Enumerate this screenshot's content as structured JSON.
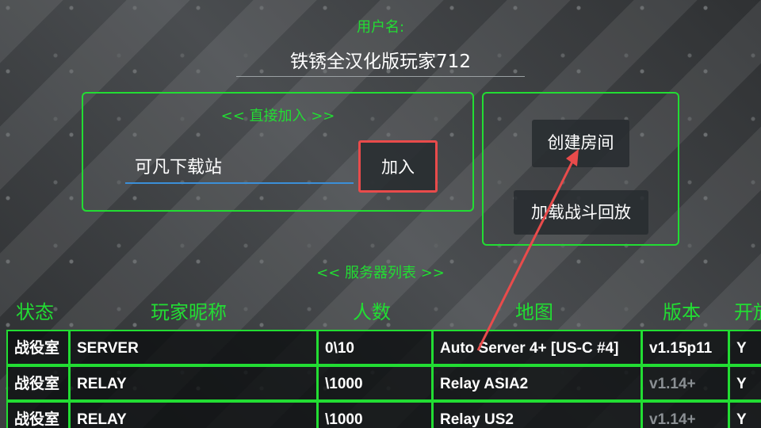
{
  "username": {
    "label": "用户名:",
    "value": "铁锈全汉化版玩家712"
  },
  "direct_join": {
    "title": "<< 直接加入 >>",
    "input_value": "可凡下载站",
    "join_label": "加入"
  },
  "room_panel": {
    "create_room_label": "创建房间",
    "load_replay_label": "加载战斗回放"
  },
  "server_list": {
    "title": "<< 服务器列表 >>",
    "columns": [
      "状态",
      "玩家昵称",
      "人数",
      "地图",
      "版本",
      "开放"
    ],
    "rows": [
      [
        "战役室",
        "SERVER",
        "0\\10",
        "Auto Server 4+ [US-C #4]",
        "v1.15p11",
        "Y"
      ],
      [
        "战役室",
        "RELAY",
        "\\1000",
        "Relay ASIA2",
        "v1.14+",
        "Y"
      ],
      [
        "战役室",
        "RELAY",
        "\\1000",
        "Relay US2",
        "v1.14+",
        "Y"
      ]
    ]
  },
  "colors": {
    "accent_green": "#22dd33",
    "highlight_red": "#e94b4b",
    "input_underline": "#3b8fd8",
    "dim_version": "#8a8f93"
  }
}
